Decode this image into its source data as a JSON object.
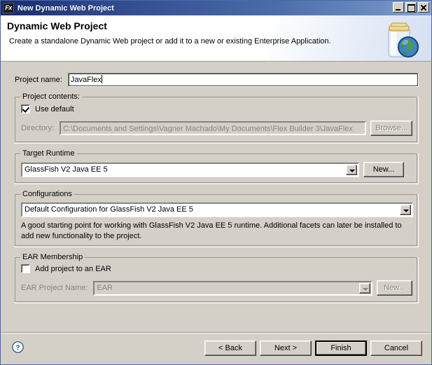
{
  "window": {
    "title": "New Dynamic Web Project",
    "icon": "Fx",
    "icon_name": "flex-builder-icon",
    "minimize_label": "Minimize",
    "maximize_label": "Maximize",
    "close_label": "Close"
  },
  "header": {
    "title": "Dynamic Web Project",
    "description": "Create a standalone Dynamic Web project or add it to a new or existing Enterprise Application.",
    "icon_name": "jar-with-globe-icon"
  },
  "project_name": {
    "label": "Project name:",
    "value": "JavaFlex"
  },
  "project_contents": {
    "group_title": "Project contents:",
    "use_default_label": "Use default",
    "use_default_checked": true,
    "directory_label": "Directory:",
    "directory_value": "C:\\Documents and Settings\\Vagner Machado\\My Documents\\Flex Builder 3\\JavaFlex",
    "browse_label": "Browse..."
  },
  "target_runtime": {
    "group_title": "Target Runtime",
    "value": "GlassFish V2 Java EE 5",
    "new_label": "New..."
  },
  "configurations": {
    "group_title": "Configurations",
    "value": "Default Configuration for GlassFish V2 Java EE 5",
    "description": "A good starting point for working with GlassFish V2 Java EE 5 runtime. Additional facets can later be installed to add new functionality to the project."
  },
  "ear_membership": {
    "group_title": "EAR Membership",
    "add_project_label": "Add project to an EAR",
    "add_project_checked": false,
    "ear_project_name_label": "EAR Project Name:",
    "ear_project_name_value": "EAR",
    "new_label": "New..."
  },
  "footer": {
    "help_label": "?",
    "back_label": "< Back",
    "next_label": "Next >",
    "finish_label": "Finish",
    "cancel_label": "Cancel"
  },
  "colors": {
    "titlebar_start": "#17296b",
    "titlebar_end": "#8aa6d2",
    "dialog_background": "#d4d0c8",
    "header_background": "#ffffff",
    "disabled_text": "#868680"
  }
}
